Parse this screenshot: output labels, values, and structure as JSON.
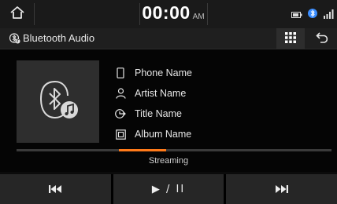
{
  "status": {
    "time": "00:00",
    "ampm": "AM"
  },
  "header": {
    "title": "Bluetooth Audio"
  },
  "track": {
    "phone_name": "Phone Name",
    "artist_name": "Artist Name",
    "title_name": "Title Name",
    "album_name": "Album Name",
    "stream_label": "Streaming",
    "progress_fraction": 0.4
  },
  "controls": {
    "prev_icon": "skip-previous-icon",
    "play_pause_label": "▶ / II",
    "next_icon": "skip-next-icon"
  },
  "colors": {
    "accent": "#ff7a1a",
    "bluetooth": "#3a8dff"
  }
}
